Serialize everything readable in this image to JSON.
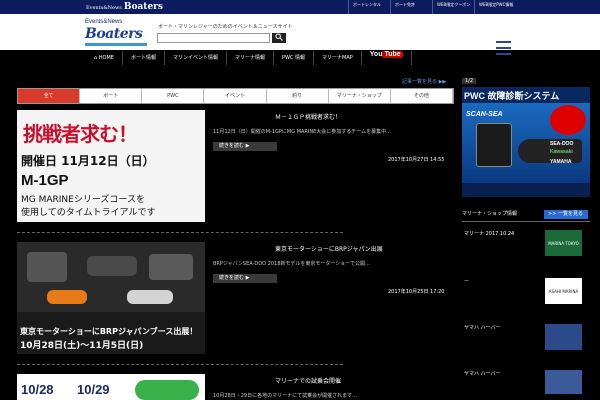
{
  "topbar": {
    "brand_small": "Events&News",
    "brand": "Boaters",
    "links": [
      "ボートレンタル",
      "ボート免許",
      "WEB限定クーポン",
      "WEB限定PWC情報"
    ]
  },
  "header": {
    "logo_small": "Events&News",
    "logo_big": "Boaters",
    "tagline": "ボート・マリンレジャーのためのイベント＆ニュースサイト",
    "search_placeholder": "",
    "search_icon": "magnifier-icon",
    "menu_icon": "hamburger-icon"
  },
  "nav": {
    "home": "HOME",
    "items": [
      "ボート情報",
      "マリンイベント情報",
      "マリーナ情報",
      "PWC 情報",
      "マリーナMAP"
    ],
    "youtube": "You",
    "youtube_tube": "Tube"
  },
  "more_link": "記事一覧を見る ▶▶",
  "page_num": "1/2",
  "tabs": [
    {
      "label": "全て",
      "active": true
    },
    {
      "label": "ボート",
      "active": false
    },
    {
      "label": "PWC",
      "active": false
    },
    {
      "label": "イベント",
      "active": false
    },
    {
      "label": "釣り",
      "active": false
    },
    {
      "label": "マリーナ・ショップ",
      "active": false
    },
    {
      "label": "その他",
      "active": false
    }
  ],
  "articles": [
    {
      "title": "Ｍ－１ＧＰ挑戦者求む！",
      "body": "11月12日（日）開催のM-1GPにMG MARINE大会に参加するチームを募集中…",
      "more": "続きを読む ▶",
      "date": "2017年10月27日 14:55",
      "thumb_lines": [
        "挑戦者求む！",
        "開催日 11月12日（日）",
        "M-1GP",
        "MG MARINEシリーズコースを",
        "使用してのタイムトライアルです"
      ]
    },
    {
      "title": "東京モーターショーにBRPジャパン出展",
      "body": "BRPジャパンSEA-DOO 2018新モデルを東京モーターショーで公開…",
      "more": "続きを読む ▶",
      "date": "2017年10月25日 17:20",
      "thumb_lines": [
        "東京モーターショーにBRPジャパンブース出展！",
        "10月28日(土)～11月5日(日)"
      ]
    },
    {
      "title": "マリーナでの試乗会開催",
      "body": "10月28日・29日に各地のマリーナにて試乗会が開催されます…",
      "more": "続きを読む ▶",
      "date": "",
      "thumb_lines": [
        "10/28",
        "10/29"
      ]
    }
  ],
  "banner": {
    "title": "PWC 故障診断システム",
    "brand1": "SCAN-SEA",
    "brand2": "SEA-DOO",
    "brand3": "Kawasaki",
    "brand4": "YAMAHA"
  },
  "sidebar": {
    "header": "マリーナ・ショップ情報",
    "button": ">> 一覧を見る",
    "items": [
      {
        "cap": "マリーナ 2017.10.24",
        "sub": "",
        "logo": "MARINA TOKYO"
      },
      {
        "cap": "ー",
        "sub": "",
        "logo": "ASAHI MARINA"
      },
      {
        "cap": "ヤマハ ハーバー",
        "sub": "",
        "logo": ""
      },
      {
        "cap": "ヤマハ ハーバー",
        "sub": "",
        "logo": ""
      }
    ]
  },
  "colors": {
    "topbar": "#0c1c5e",
    "accent": "#d93a2a",
    "link": "#2a6ad0"
  }
}
